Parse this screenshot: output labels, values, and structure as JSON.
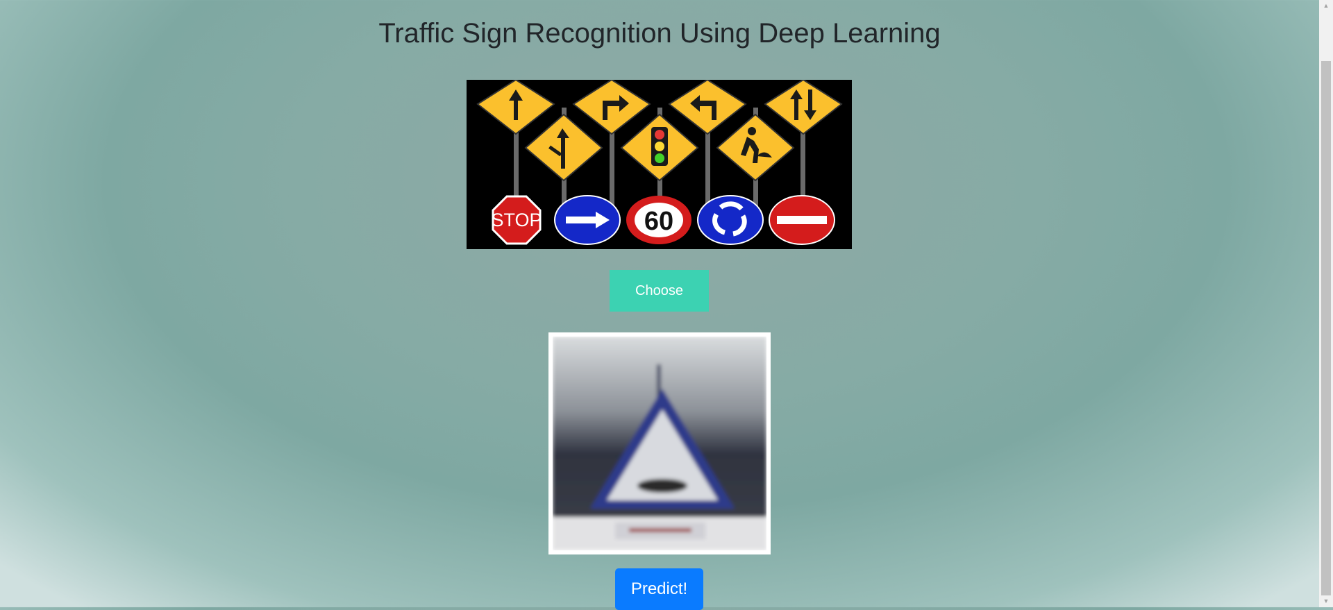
{
  "header": {
    "title": "Traffic Sign Recognition Using Deep Learning"
  },
  "banner": {
    "signs_row1": [
      "up-arrow-sign",
      "right-turn-sign",
      "left-turn-sign",
      "two-way-sign"
    ],
    "signs_row2": [
      "side-road-sign",
      "traffic-light-sign",
      "roadwork-sign"
    ],
    "signs_row3": [
      "STOP",
      "one-way-right-sign",
      "60",
      "roundabout-sign",
      "no-entry-sign"
    ]
  },
  "actions": {
    "choose_label": "Choose",
    "predict_label": "Predict!"
  },
  "colors": {
    "choose": "#3cd2b2",
    "predict": "#0a7bff",
    "warning_yellow": "#fbc02d",
    "stop_red": "#d41c1c",
    "mandatory_blue": "#1428c8"
  }
}
